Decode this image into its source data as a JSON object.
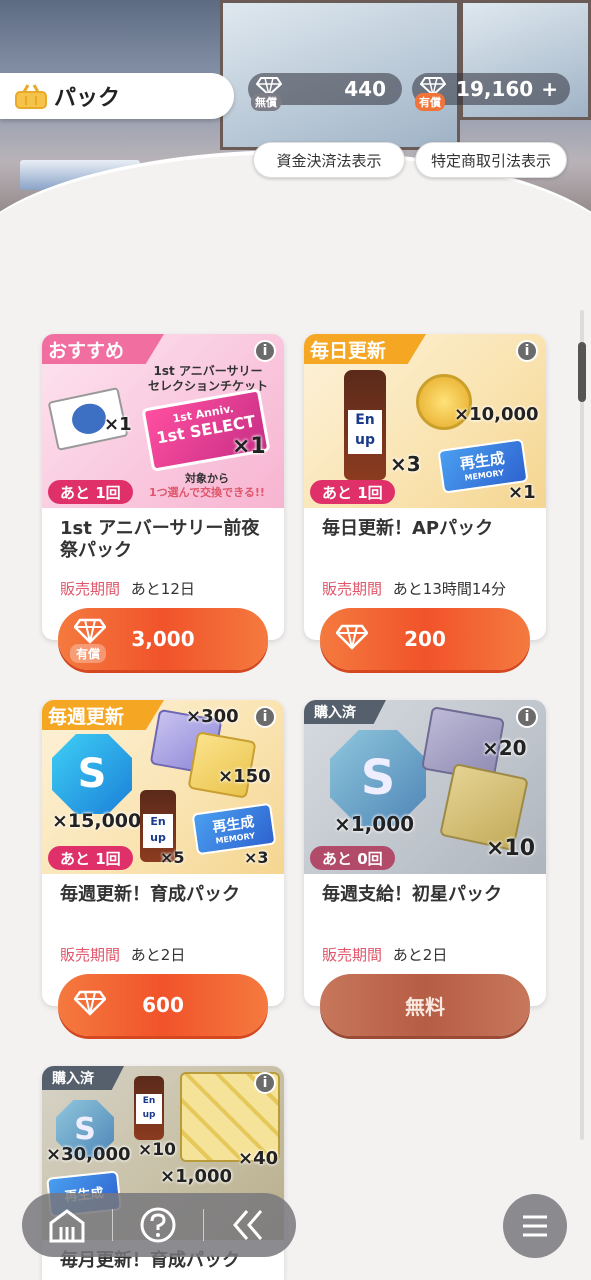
{
  "header": {
    "title": "パック",
    "free_gems": {
      "tag": "無償",
      "value": "440"
    },
    "paid_gems": {
      "tag": "有償",
      "value": "19,160",
      "plus": "+"
    },
    "buttons": {
      "payment_law": "資金決済法表示",
      "commercial_law": "特定商取引法表示"
    }
  },
  "cards": [
    {
      "ribbon": "おすすめ",
      "ribbon_color": "#f06fa0",
      "banner_line1": "1st アニバーサリー",
      "banner_line2": "セレクションチケット",
      "ticket_small": "1st Anniv.",
      "ticket_big": "1st SELECT",
      "qty_tickets": "×1",
      "qty_ticket": "×1",
      "note_line1": "対象から",
      "note_line2": "1つ選んで交換できる!!",
      "remain": "あと 1回",
      "name": "1st アニバーサリー前夜祭パック",
      "period_label": "販売期間",
      "period_value": "あと12日",
      "price": "3,000",
      "price_tag": "有償"
    },
    {
      "ribbon": "毎日更新",
      "ribbon_color": "#f5a623",
      "bottle_text": "En up",
      "qty_bottle": "×3",
      "qty_coin": "×10,000",
      "qty_memory": "×1",
      "memory_label": "再生成",
      "memory_sub": "MEMORY",
      "remain": "あと 1回",
      "name": "毎日更新！APパック",
      "period_label": "販売期間",
      "period_value": "あと13時間14分",
      "price": "200"
    },
    {
      "ribbon": "毎週更新",
      "ribbon_color": "#f5a623",
      "s_badge": "S",
      "qty_s": "×15,000",
      "qty_book1": "×300",
      "qty_book2": "×150",
      "qty_bottle": "×5",
      "qty_memory": "×3",
      "bottle_text": "En up",
      "memory_label": "再生成",
      "memory_sub": "MEMORY",
      "remain": "あと 1回",
      "name": "毎週更新！育成パック",
      "period_label": "販売期間",
      "period_value": "あと2日",
      "price": "600"
    },
    {
      "ribbon": "購入済",
      "s_badge": "S",
      "qty_s": "×1,000",
      "qty_book1": "×20",
      "qty_book2": "×10",
      "remain": "あと 0回",
      "name": "毎週支給！初星パック",
      "period_label": "販売期間",
      "period_value": "あと2日",
      "price": "無料"
    },
    {
      "ribbon": "購入済",
      "s_badge": "S",
      "qty_s": "×30,000",
      "qty_bottle": "×10",
      "qty_book": "×40",
      "qty_b": "×1,000",
      "bottle_text": "En up",
      "memory_label": "再生成",
      "name": "毎月更新！育成パック"
    }
  ],
  "colors": {
    "accent": "#f1532a",
    "pink": "#e0566a",
    "nav": "#78787d"
  },
  "nav": {
    "icons": [
      "home-icon",
      "help-icon",
      "back-icon"
    ],
    "menu_icon": "hamburger-icon"
  }
}
